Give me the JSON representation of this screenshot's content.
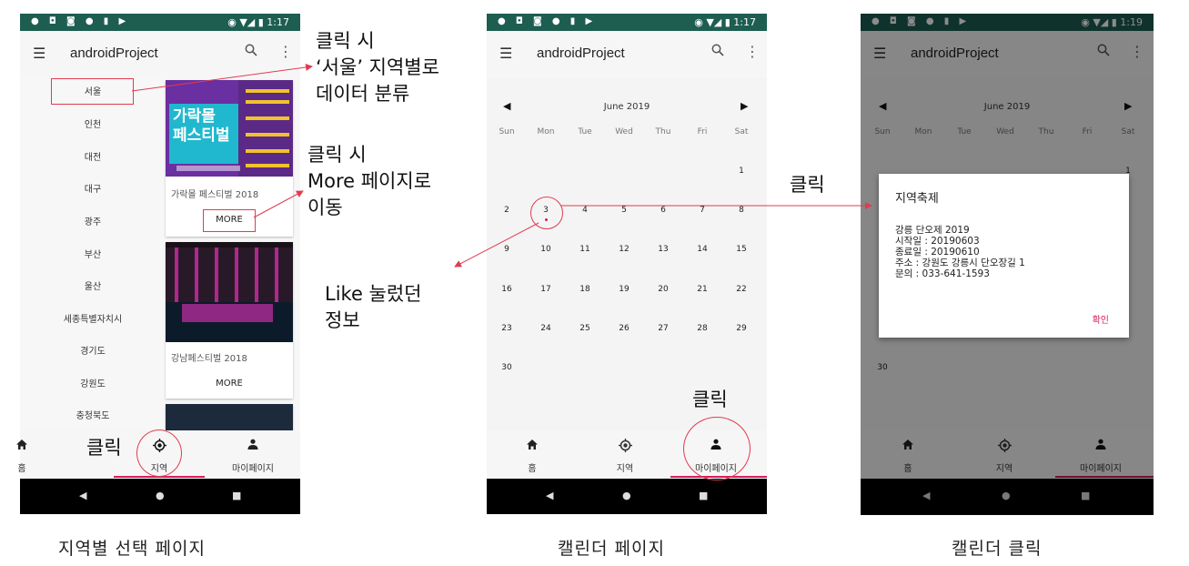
{
  "phones": [
    {
      "time": "1:17",
      "app_title": "androidProject"
    },
    {
      "time": "1:17",
      "app_title": "androidProject"
    },
    {
      "time": "1:19",
      "app_title": "androidProject"
    }
  ],
  "nav": {
    "home": "홈",
    "region": "지역",
    "mypage": "마이페이지"
  },
  "regions": [
    "서울",
    "인천",
    "대전",
    "대구",
    "광주",
    "부산",
    "울산",
    "세종특별자치시",
    "경기도",
    "강원도",
    "충청북도"
  ],
  "cards": [
    {
      "title": "가락몰 페스티벌 2018",
      "more": "MORE",
      "poster_text": "가락몰\n페스티벌"
    },
    {
      "title": "강남페스티벌 2018",
      "more": "MORE"
    }
  ],
  "calendar": {
    "month": "June 2019",
    "dow": [
      "Sun",
      "Mon",
      "Tue",
      "Wed",
      "Thu",
      "Fri",
      "Sat"
    ],
    "days": [
      "1",
      "2",
      "3",
      "4",
      "5",
      "6",
      "7",
      "8",
      "9",
      "10",
      "11",
      "12",
      "13",
      "14",
      "15",
      "16",
      "17",
      "18",
      "19",
      "20",
      "21",
      "22",
      "23",
      "24",
      "25",
      "26",
      "27",
      "28",
      "29",
      "30"
    ]
  },
  "dialog": {
    "title": "지역축제",
    "lines": [
      "강릉 단오제 2019",
      "시작일 : 20190603",
      "종료일 : 20190610",
      "주소 : 강원도 강릉시 단오장길 1",
      "문의 : 033-641-1593"
    ],
    "ok": "확인"
  },
  "annotations": {
    "seoul_click": [
      "클릭 시",
      "‘서울’ 지역별로",
      "데이터 분류"
    ],
    "more_click": [
      "클릭 시",
      "More 페이지로",
      "이동"
    ],
    "like_info": [
      "Like 눌렀던",
      "정보"
    ],
    "click": "클릭"
  },
  "captions": [
    "지역별 선택 페이지",
    "캘린더 페이지",
    "캘린더 클릭"
  ],
  "colors": {
    "status_bar": "#1d5e51",
    "accent": "#d81b60",
    "annotation": "#e03c4f"
  }
}
